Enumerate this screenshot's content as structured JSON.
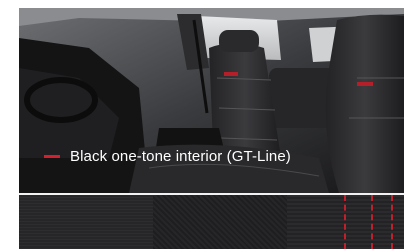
{
  "caption": {
    "text": "Black one-tone interior (GT-Line)",
    "accent_color": "#d2202e"
  },
  "swatches": [
    {
      "name": "leather-texture"
    },
    {
      "name": "woven-texture"
    },
    {
      "name": "red-stitching"
    }
  ],
  "icons": [
    "red-dash-marker"
  ]
}
